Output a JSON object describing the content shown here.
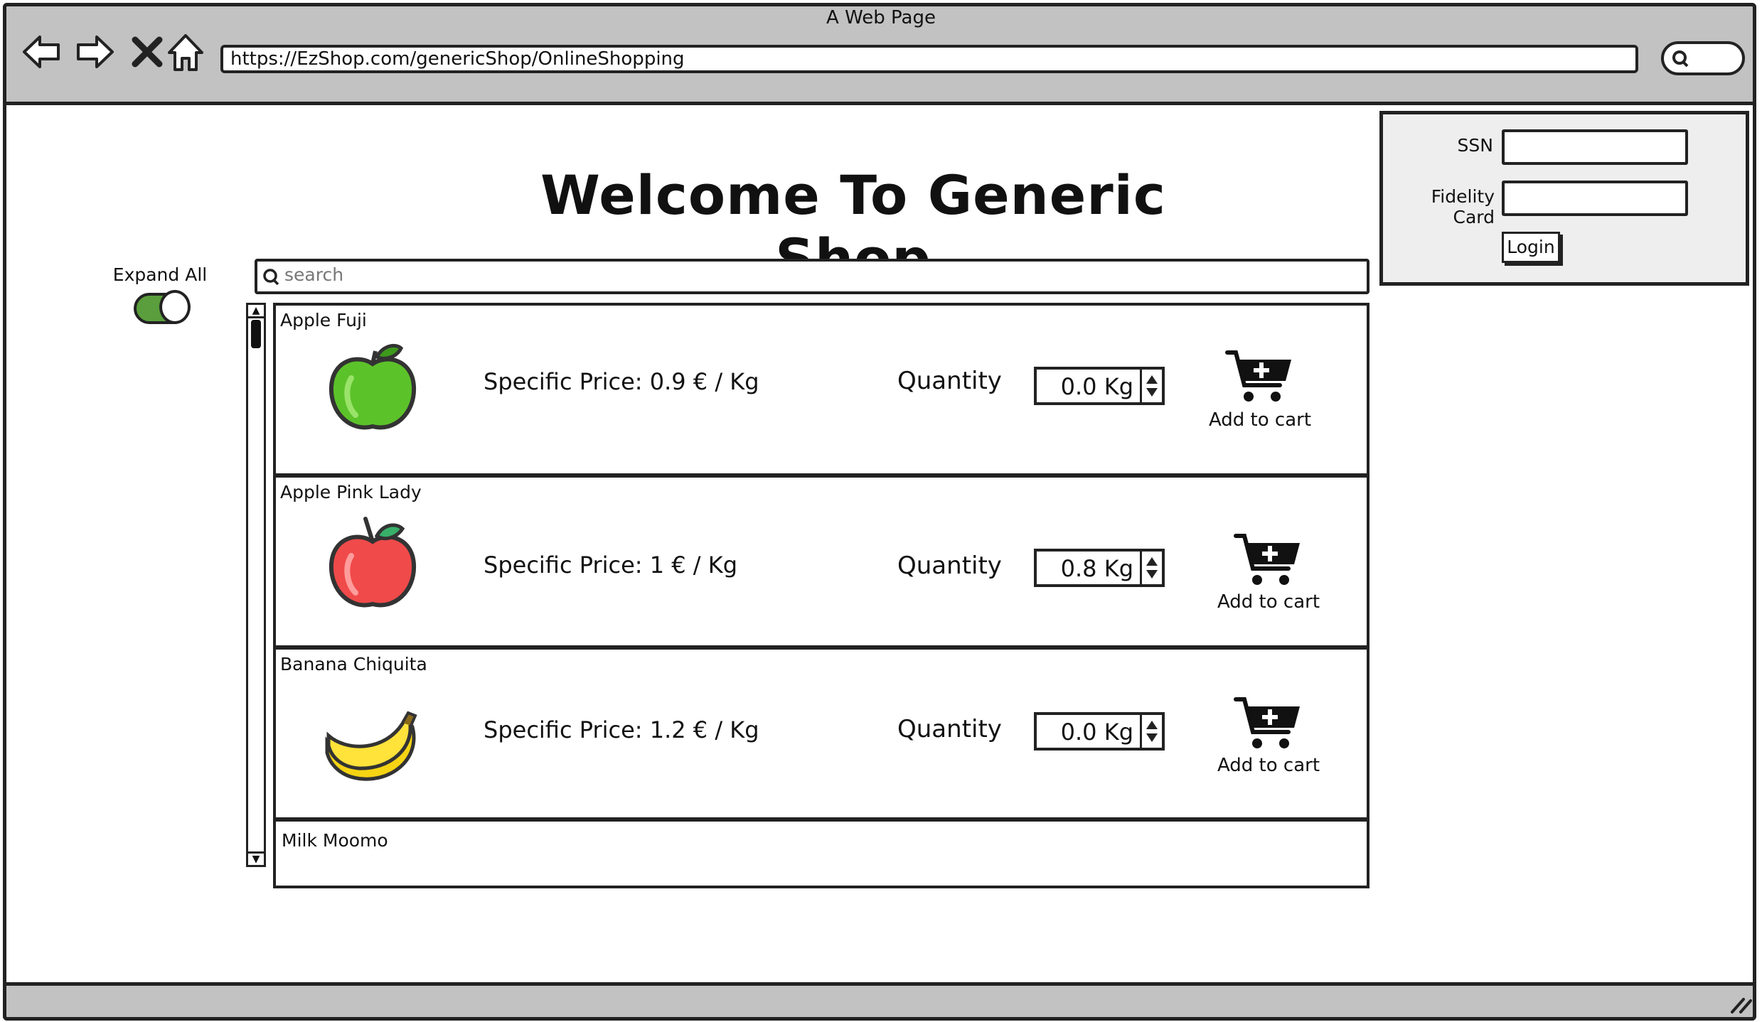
{
  "window": {
    "title": "A Web Page",
    "url": "https://EzShop.com/genericShop/OnlineShopping"
  },
  "page": {
    "title": "Welcome To Generic Shop"
  },
  "expand": {
    "label": "Expand All",
    "enabled": true
  },
  "search": {
    "placeholder": "search"
  },
  "login": {
    "ssn_label": "SSN",
    "fidelity_label": "Fidelity Card",
    "button_label": "Login"
  },
  "products": [
    {
      "name": "Apple Fuji",
      "price": "Specific Price: 0.9 € / Kg",
      "quantity_label": "Quantity",
      "quantity": "0.0 Kg",
      "cart_label": "Add to cart",
      "icon": "green-apple-icon"
    },
    {
      "name": "Apple Pink Lady",
      "price": "Specific Price: 1 € / Kg",
      "quantity_label": "Quantity",
      "quantity": "0.8 Kg",
      "cart_label": "Add to cart",
      "icon": "red-apple-icon"
    },
    {
      "name": "Banana Chiquita",
      "price": "Specific Price: 1.2 € / Kg",
      "quantity_label": "Quantity",
      "quantity": "0.0 Kg",
      "cart_label": "Add to cart",
      "icon": "banana-icon"
    },
    {
      "name": "Milk Moomo"
    }
  ],
  "colors": {
    "chrome": "#c2c2c2",
    "toggle_on": "#5a9e3d",
    "login_panel": "#eeeeee"
  }
}
